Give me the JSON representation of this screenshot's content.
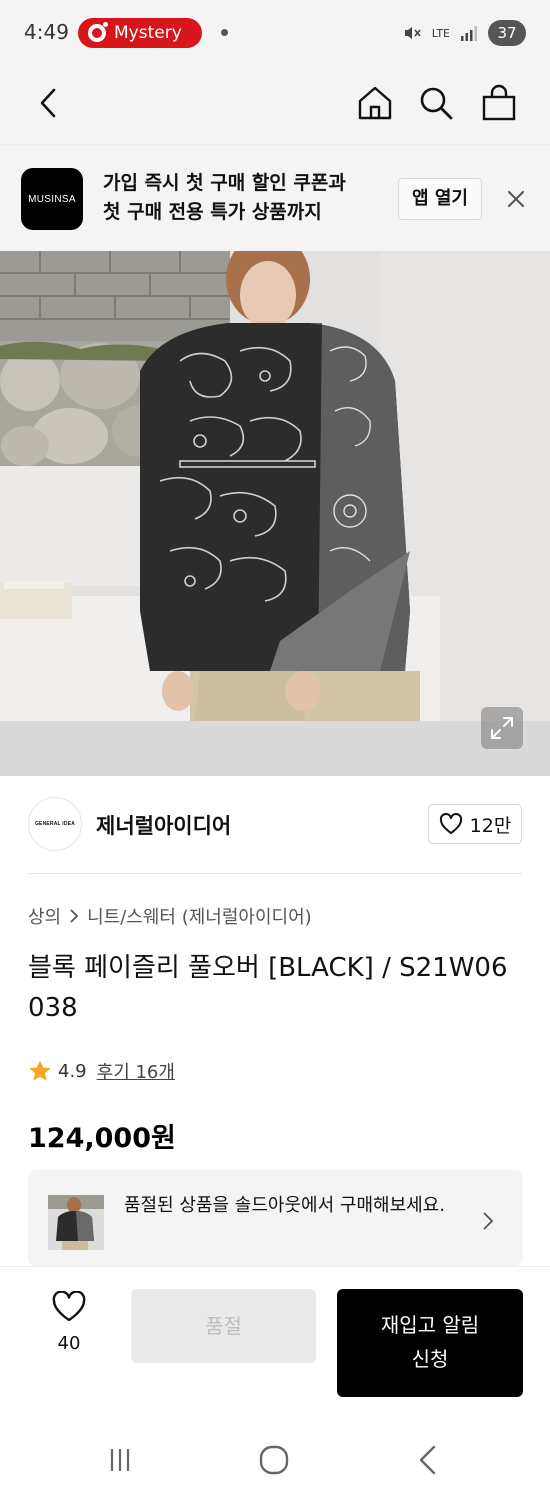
{
  "status_bar": {
    "time": "4:49",
    "notification_label": "Mystery",
    "network": "LTE",
    "battery": "37"
  },
  "nav": {
    "icons": [
      "back-icon",
      "home-icon",
      "search-icon",
      "shopping-bag-icon"
    ]
  },
  "app_banner": {
    "logo_text": "MUSINSA",
    "line1": "가입 즉시 첫 구매 할인 쿠폰과",
    "line2": "첫 구매 전용 특가 상품까지",
    "open_app_label": "앱 열기"
  },
  "brand": {
    "avatar_text": "GENERAL IDEA",
    "name": "제너럴아이디어",
    "like_count": "12만"
  },
  "product": {
    "breadcrumb_root": "상의",
    "breadcrumb_child": "니트/스웨터 (제너럴아이디어)",
    "title": "블록 페이즐리 풀오버 [BLACK] / S21W06038",
    "rating": "4.9",
    "review_text": "후기 16개",
    "price": "124,000원"
  },
  "soldout_notice": {
    "text": "품절된 상품을 솔드아웃에서 구매해보세요."
  },
  "bottom_bar": {
    "wish_count": "40",
    "soldout_label": "품절",
    "restock_line1": "재입고 알림",
    "restock_line2": "신청"
  },
  "colors": {
    "accent_red": "#d7161c",
    "star": "#f5a623",
    "black": "#000000",
    "background_gray": "#f4f4f4"
  }
}
